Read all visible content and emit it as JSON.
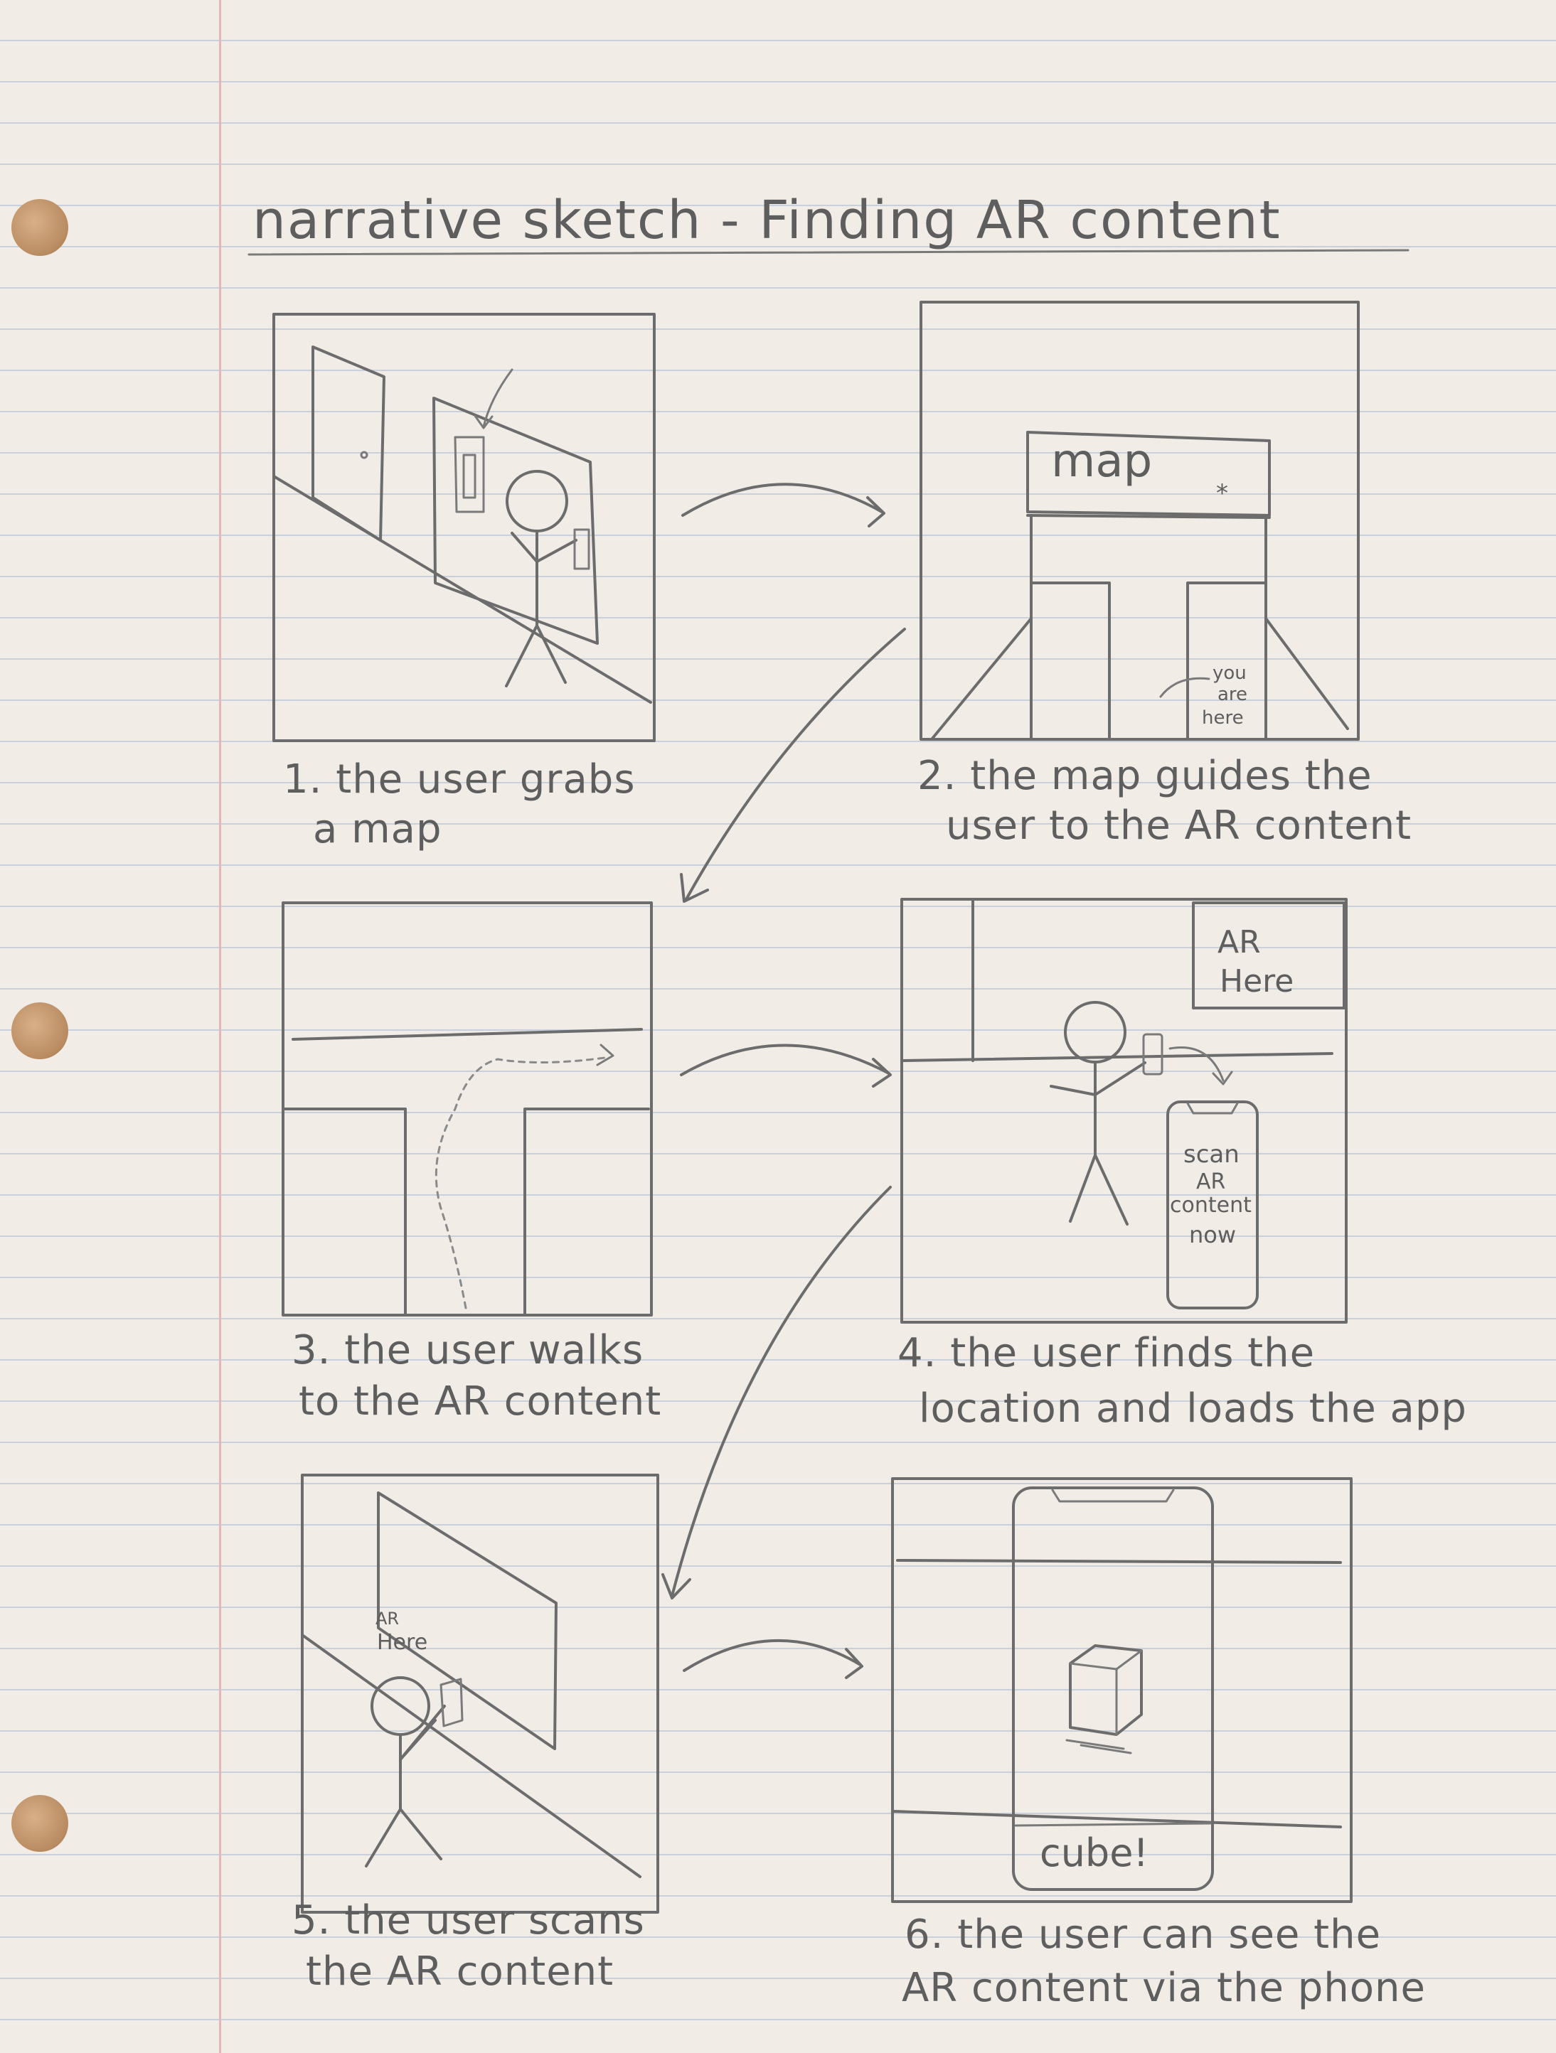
{
  "title": "narrative sketch - Finding AR content",
  "panels": [
    {
      "caption_line1": "1. the user grabs",
      "caption_line2": "a map"
    },
    {
      "caption_line1": "2. the map guides the",
      "caption_line2": "user to the AR content",
      "map_label": "map",
      "star": "*",
      "you_are_here": [
        "you",
        "are",
        "here"
      ]
    },
    {
      "caption_line1": "3. the user walks",
      "caption_line2": "to the AR content"
    },
    {
      "caption_line1": "4. the user finds the",
      "caption_line2": "location and loads the app",
      "sign_line1": "AR",
      "sign_line2": "Here",
      "phone_text": [
        "scan",
        "AR",
        "content",
        "now"
      ]
    },
    {
      "caption_line1": "5. the user scans",
      "caption_line2": "the AR content",
      "sign_line1": "AR",
      "sign_line2": "Here"
    },
    {
      "caption_line1": "6. the user can see the",
      "caption_line2": "AR content via the phone",
      "phone_label": "cube!"
    }
  ]
}
